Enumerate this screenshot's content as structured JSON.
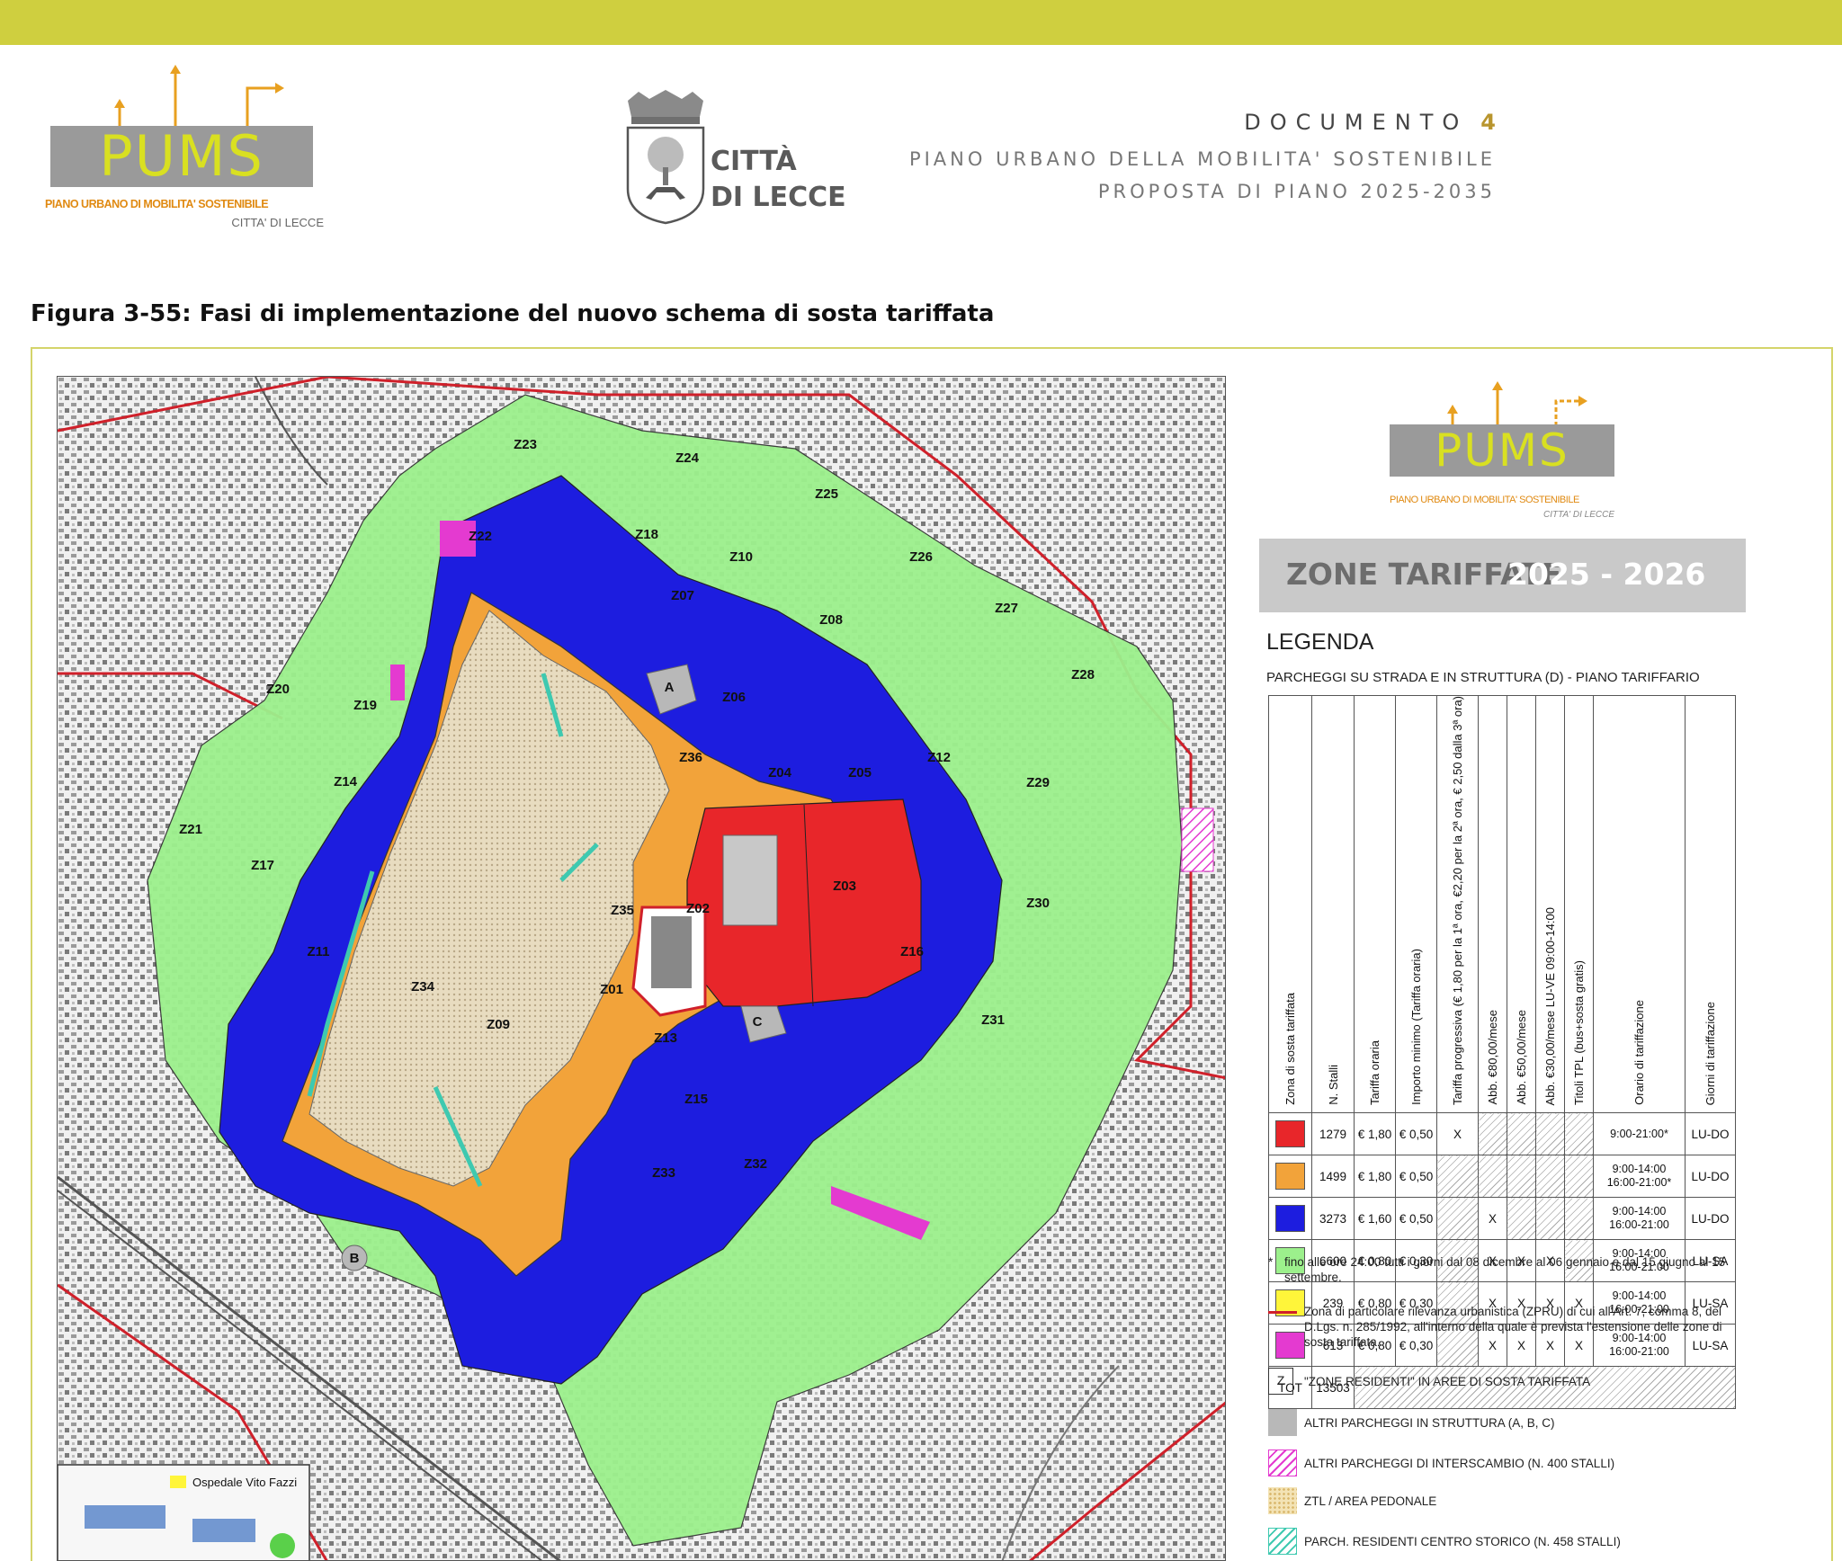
{
  "header": {
    "logo": {
      "word": "PUMS",
      "line1": "PIANO URBANO DI MOBILITA' SOSTENIBILE",
      "line2": "CITTA' DI LECCE"
    },
    "city": {
      "line1": "CITTÀ",
      "line2": "DI LECCE",
      "crest_icon": "city-crest-icon"
    },
    "document": {
      "label": "DOCUMENTO",
      "number": "4",
      "line2": "PIANO URBANO DELLA MOBILITA' SOSTENIBILE",
      "line3": "PROPOSTA DI PIANO 2025-2035"
    }
  },
  "figure": {
    "caption": "Figura 3-55: Fasi di implementazione del nuovo schema di sosta tariffata"
  },
  "map": {
    "zones": {
      "red": [
        "Z04",
        "Z05"
      ],
      "orange": [
        "Z06",
        "Z14",
        "Z35",
        "Z02",
        "Z01",
        "Z34"
      ],
      "blue": [
        "Z22",
        "Z07",
        "Z08",
        "Z19",
        "Z12",
        "Z17",
        "Z03",
        "Z11",
        "Z09",
        "Z13"
      ],
      "green": [
        "Z23",
        "Z24",
        "Z25",
        "Z18",
        "Z10",
        "Z26",
        "Z27",
        "Z20",
        "Z28",
        "Z29",
        "Z21",
        "Z30",
        "Z16",
        "Z31",
        "Z15",
        "Z33",
        "Z32"
      ],
      "magenta": [
        "D"
      ]
    },
    "special_labels": [
      "Z36",
      "A",
      "B",
      "C",
      "D",
      "Z"
    ],
    "inset_label": "Ospedale Vito Fazzi",
    "colors": {
      "red": "#e8262a",
      "orange": "#f2a33a",
      "blue": "#1d1ddf",
      "green": "#9cf08c",
      "yellow": "#fff53a",
      "magenta": "#e43ad0",
      "ztl": "#e8d9b5",
      "zpru": "#d0202a",
      "teal": "#3ec9b0",
      "gray": "#b8b8b8"
    }
  },
  "legend": {
    "logo": {
      "word": "PUMS",
      "line1": "PIANO URBANO DI MOBILITA' SOSTENIBILE",
      "line2": "CITTA' DI LECCE"
    },
    "banner": {
      "title": "ZONE TARIFFATE",
      "years": "2025 - 2026"
    },
    "heading": "LEGENDA",
    "table_title": "PARCHEGGI SU STRADA E IN STRUTTURA (D) - PIANO TARIFFARIO",
    "columns": [
      "Zona di sosta tariffata",
      "N. Stalli",
      "Tariffa oraria",
      "Importo minimo (Tariffa oraria)",
      "Tariffa progressiva (€ 1,80 per la 1ª ora, €2,20 per la 2ª ora, € 2,50 dalla 3ª ora)",
      "Abb. €80,00/mese",
      "Abb. €50,00/mese",
      "Abb. €30,00/mese LU-VE 09:00-14:00",
      "Titoli TPL (bus+sosta gratis)",
      "Orario di tariffazione",
      "Giorni di tariffazione"
    ],
    "rows": [
      {
        "color": "#e8262a",
        "stalli": "1279",
        "oraria": "€ 1,80",
        "minimo": "€ 0,50",
        "progressiva": "X",
        "abb80": "",
        "abb50": "",
        "abb30": "",
        "tpl": "",
        "orario": [
          "9:00-21:00*"
        ],
        "giorni": "LU-DO"
      },
      {
        "color": "#f2a33a",
        "stalli": "1499",
        "oraria": "€ 1,80",
        "minimo": "€ 0,50",
        "progressiva": "",
        "abb80": "",
        "abb50": "",
        "abb30": "",
        "tpl": "",
        "orario": [
          "9:00-14:00",
          "16:00-21:00*"
        ],
        "giorni": "LU-DO"
      },
      {
        "color": "#1d1ddf",
        "stalli": "3273",
        "oraria": "€ 1,60",
        "minimo": "€ 0,50",
        "progressiva": "",
        "abb80": "X",
        "abb50": "",
        "abb30": "",
        "tpl": "",
        "orario": [
          "9:00-14:00",
          "16:00-21:00"
        ],
        "giorni": "LU-DO"
      },
      {
        "color": "#9cf08c",
        "stalli": "6600",
        "oraria": "€ 0,80",
        "minimo": "€ 0,30",
        "progressiva": "",
        "abb80": "X",
        "abb50": "X",
        "abb30": "X",
        "tpl": "",
        "orario": [
          "9:00-14:00",
          "16:00-21:00"
        ],
        "giorni": "LU-SA"
      },
      {
        "color": "#fff53a",
        "stalli": "239",
        "oraria": "€ 0,80",
        "minimo": "€ 0,30",
        "progressiva": "",
        "abb80": "X",
        "abb50": "X",
        "abb30": "X",
        "tpl": "X",
        "orario": [
          "9:00-14:00",
          "16:00-21:00"
        ],
        "giorni": "LU-SA"
      },
      {
        "color": "#e43ad0",
        "stalli": "613",
        "oraria": "€ 0,80",
        "minimo": "€ 0,30",
        "progressiva": "",
        "abb80": "X",
        "abb50": "X",
        "abb30": "X",
        "tpl": "X",
        "orario": [
          "9:00-14:00",
          "16:00-21:00"
        ],
        "giorni": "LU-SA"
      }
    ],
    "total": {
      "label": "TOT",
      "value": "13503"
    },
    "note_star": {
      "mark": "*",
      "text": "fino alle ore 24:00 tutti i giorni dal 08 dicembre al 06 gennaio e dal 15 giugno al 15 settembre."
    },
    "items": [
      {
        "symbol": "red-line",
        "text": "Zona di particolare rilevanza urbanistica (ZPRU) di cui all'Art. 7, comma 8, del D.Lgs. n. 285/1992, all'interno della quale è prevista l'estensione delle zone di sosta tariffata."
      },
      {
        "symbol": "z-box",
        "text": "\"ZONE RESIDENTI\" IN AREE DI SOSTA TARIFFATA"
      },
      {
        "symbol": "gray-box",
        "text": "ALTRI PARCHEGGI IN STRUTTURA (A, B, C)"
      },
      {
        "symbol": "magenta-hatch",
        "text": "ALTRI PARCHEGGI DI INTERSCAMBIO (N. 400 STALLI)"
      },
      {
        "symbol": "ztl-dots",
        "text": "ZTL / AREA PEDONALE"
      },
      {
        "symbol": "teal-hatch",
        "text": "PARCH. RESIDENTI CENTRO STORICO (N. 458 STALLI)"
      }
    ]
  }
}
